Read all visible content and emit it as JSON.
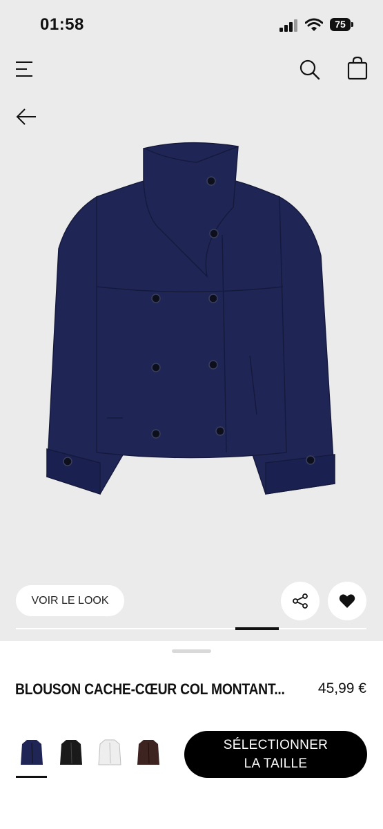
{
  "status_bar": {
    "time": "01:58",
    "battery": "75"
  },
  "header": {
    "menu_icon": "menu-icon",
    "search_icon": "search-icon",
    "bag_icon": "bag-icon",
    "back_icon": "arrow-left-icon"
  },
  "product_image": {
    "description_icon": "jacket-image",
    "color": "#1f2656"
  },
  "actions": {
    "look_label": "VOIR LE LOOK",
    "share_icon": "share-icon",
    "favorite_icon": "heart-icon"
  },
  "gallery": {
    "progress": 0.7
  },
  "product": {
    "name": "BLOUSON CACHE-CŒUR COL MONTANT...",
    "price": "45,99 €",
    "colors": [
      {
        "name": "navy",
        "hex": "#1f2656",
        "selected": true
      },
      {
        "name": "black",
        "hex": "#1a1a1a",
        "selected": false
      },
      {
        "name": "white",
        "hex": "#eeeeee",
        "selected": false
      },
      {
        "name": "brown",
        "hex": "#3e2420",
        "selected": false
      }
    ],
    "cta_line1": "SÉLECTIONNER",
    "cta_line2": "LA TAILLE"
  }
}
